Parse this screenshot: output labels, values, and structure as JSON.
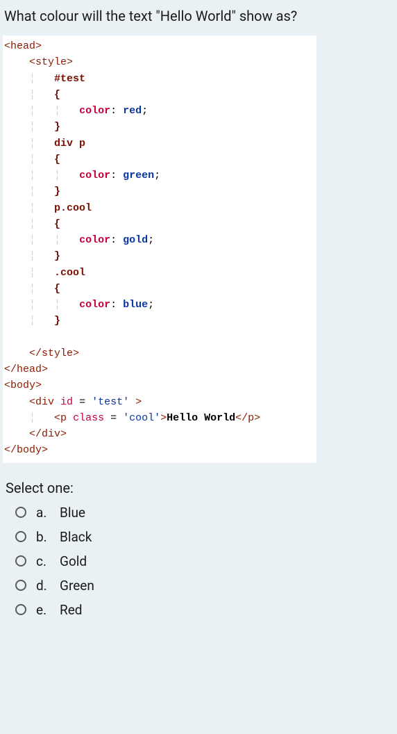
{
  "question": "What colour will the text \"Hello World\" show as?",
  "code": {
    "head_open": "<head>",
    "style_open": "<style>",
    "sel1": "#test",
    "brace_open": "{",
    "rule1_prop": "color",
    "rule1_val": "red",
    "brace_close": "}",
    "sel2": "div p",
    "rule2_prop": "color",
    "rule2_val": "green",
    "sel3": "p.cool",
    "rule3_prop": "color",
    "rule3_val": "gold",
    "sel4": ".cool",
    "rule4_prop": "color",
    "rule4_val": "blue",
    "style_close": "</style>",
    "head_close": "</head>",
    "body_open": "<body>",
    "div_open_pre": "<div",
    "div_id_attr": "id",
    "div_id_val": "'test'",
    "div_open_post": ">",
    "p_open_pre": "<p",
    "p_class_attr": "class",
    "p_class_val": "'cool'",
    "p_open_post": ">",
    "p_text": "Hello World",
    "p_close": "</p>",
    "div_close": "</div>",
    "body_close": "</body>",
    "eq": " = ",
    "semi": ";",
    "colon": ": "
  },
  "select_label": "Select one:",
  "options": [
    {
      "letter": "a.",
      "label": "Blue"
    },
    {
      "letter": "b.",
      "label": "Black"
    },
    {
      "letter": "c.",
      "label": "Gold"
    },
    {
      "letter": "d.",
      "label": "Green"
    },
    {
      "letter": "e.",
      "label": "Red"
    }
  ]
}
